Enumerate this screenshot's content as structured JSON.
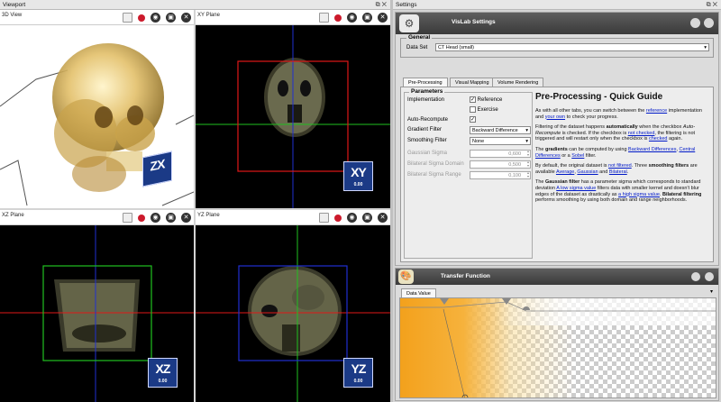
{
  "viewport": {
    "title": "Viewport",
    "panes": {
      "view3d": {
        "label": "3D View",
        "badge": "ZX",
        "badge_sub": ""
      },
      "xy": {
        "label": "XY Plane",
        "badge": "XY",
        "badge_sub": "0.00"
      },
      "xz": {
        "label": "XZ Plane",
        "badge": "XZ",
        "badge_sub": "0.00"
      },
      "yz": {
        "label": "YZ Plane",
        "badge": "YZ",
        "badge_sub": "0.00"
      }
    }
  },
  "settings": {
    "title": "Settings",
    "panel_title": "VisLab Settings",
    "general": {
      "label": "General",
      "dataset_label": "Data Set",
      "dataset_value": "CT Head (small)"
    },
    "tabs": [
      "Pre-Processing",
      "Visual Mapping",
      "Volume Rendering"
    ],
    "parameters": {
      "label": "Parameters",
      "implementation_label": "Implementation",
      "reference_label": "Reference",
      "exercise_label": "Exercise",
      "auto_recompute_label": "Auto-Recompute",
      "gradient_filter_label": "Gradient Filter",
      "gradient_filter_value": "Backward Difference",
      "smoothing_filter_label": "Smoothing Filter",
      "smoothing_filter_value": "None",
      "gaussian_sigma_label": "Gaussian Sigma",
      "gaussian_sigma_value": "0,600",
      "bilateral_domain_label": "Bilateral Sigma Domain",
      "bilateral_domain_value": "0,500",
      "bilateral_range_label": "Bilateral Sigma Range",
      "bilateral_range_value": "0,100"
    },
    "guide": {
      "title": "Pre-Processing - Quick Guide",
      "p1_a": "As with all other tabs, you can switch between the ",
      "p1_link1": "reference",
      "p1_b": " implementation and ",
      "p1_link2": "your own",
      "p1_c": " to check your progress.",
      "p2_a": "Filtering of the dataset happens ",
      "p2_bold": "automatically",
      "p2_b": " when the checkbox ",
      "p2_italic": "Auto-Recompute",
      "p2_c": " is checked. If the checkbox is ",
      "p2_link1": "not checked",
      "p2_d": ", the filtering is not triggered and will restart only when the checkbox is ",
      "p2_link2": "checked",
      "p2_e": " again.",
      "p3_a": "The ",
      "p3_bold": "gradients",
      "p3_b": " can be computed by using ",
      "p3_link1": "Backward Differences",
      "p3_c": ", ",
      "p3_link2": "Central Differences",
      "p3_d": " or a ",
      "p3_link3": "Sobel",
      "p3_e": " filter.",
      "p4_a": "By default, the original dataset is ",
      "p4_link1": "not filtered",
      "p4_b": ". Three ",
      "p4_bold": "smoothing filters",
      "p4_c": " are available ",
      "p4_link2": "Average",
      "p4_d": ", ",
      "p4_link3": "Gaussian",
      "p4_e": " and ",
      "p4_link4": "Bilateral",
      "p4_f": ".",
      "p5_a": "The ",
      "p5_bold1": "Gaussian filter",
      "p5_b": " has a parameter sigma which corresponds to standard deviation ",
      "p5_link1": "A low sigma value",
      "p5_c": " filters data with smaller kernel and doesn't blur edges of the dataset as drastically as ",
      "p5_link2": "a high sigma value",
      "p5_d": ". ",
      "p5_bold2": "Bilateral filtering",
      "p5_e": " performs smoothing by using both domain and range neighborhoods."
    },
    "transfer": {
      "title": "Transfer Function",
      "tab": "Data Value"
    }
  },
  "colors": {
    "accent_blue": "#1b3a86",
    "link": "#0019c8",
    "xy_box": "#e01818",
    "xz_box": "#20c020",
    "yz_box": "#2030d0"
  }
}
